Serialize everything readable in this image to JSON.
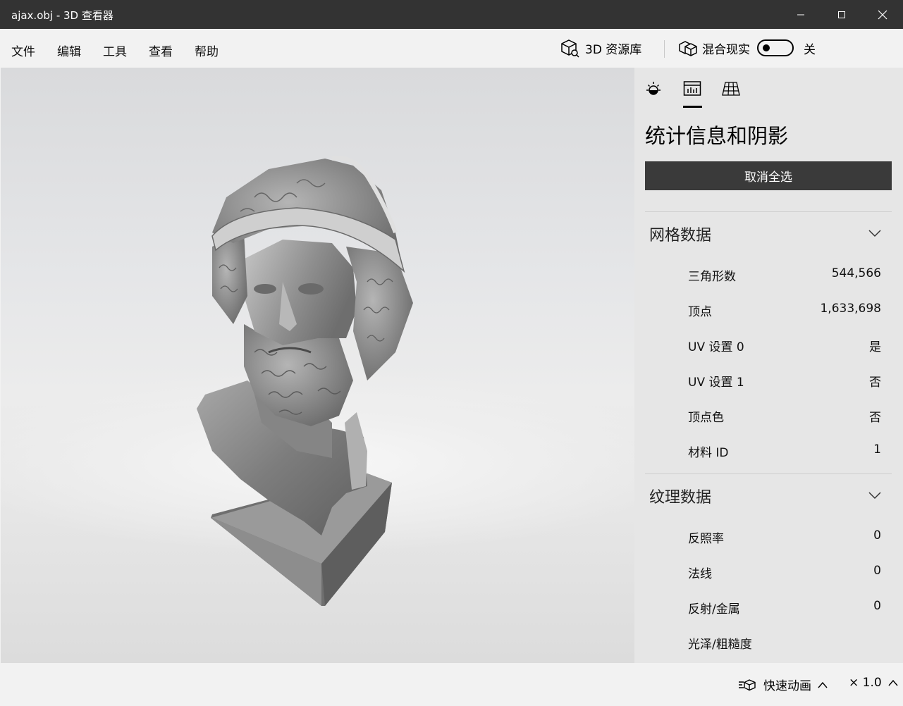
{
  "window": {
    "title": "ajax.obj - 3D 查看器"
  },
  "menu": {
    "items": [
      "文件",
      "编辑",
      "工具",
      "查看",
      "帮助"
    ]
  },
  "toolbar": {
    "library_label": "3D 资源库",
    "mixed_reality_label": "混合现实",
    "toggle_state_label": "关"
  },
  "panel": {
    "title": "统计信息和阴影",
    "deselect_label": "取消全选",
    "mesh": {
      "title": "网格数据",
      "rows": [
        {
          "label": "三角形数",
          "value": "544,566"
        },
        {
          "label": "顶点",
          "value": "1,633,698"
        },
        {
          "label": "UV 设置 0",
          "value": "是"
        },
        {
          "label": "UV 设置 1",
          "value": "否"
        },
        {
          "label": "顶点色",
          "value": "否"
        },
        {
          "label": "材料 ID",
          "value": "1"
        }
      ]
    },
    "texture": {
      "title": "纹理数据",
      "rows": [
        {
          "label": "反照率",
          "value": "0"
        },
        {
          "label": "法线",
          "value": "0"
        },
        {
          "label": "反射/金属",
          "value": "0"
        },
        {
          "label": "光泽/粗糙度",
          "value": ""
        }
      ]
    }
  },
  "statusbar": {
    "animation_label": "快速动画",
    "speed_label": "× 1.0"
  },
  "colors": {
    "titlebar": "#333333",
    "button_dark": "#3a3a3a",
    "panel_bg": "#e6e6e6"
  }
}
